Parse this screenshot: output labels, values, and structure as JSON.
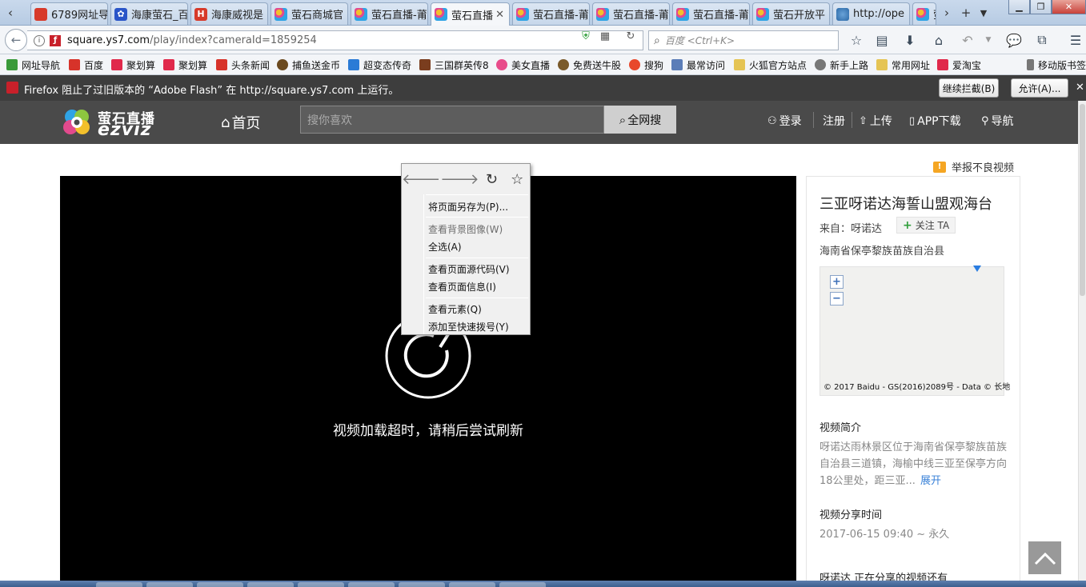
{
  "browser": {
    "tabs": [
      {
        "label": "6789网址导",
        "icon": "red"
      },
      {
        "label": "海康萤石_百",
        "icon": "blue"
      },
      {
        "label": "海康威视是",
        "icon": "red"
      },
      {
        "label": "萤石商城官",
        "icon": "flower"
      },
      {
        "label": "萤石直播-莆",
        "icon": "flower"
      },
      {
        "label": "萤石直播",
        "icon": "flower",
        "active": true
      },
      {
        "label": "萤石直播-莆",
        "icon": "flower"
      },
      {
        "label": "萤石直播-莆",
        "icon": "flower"
      },
      {
        "label": "萤石直播-莆",
        "icon": "flower"
      },
      {
        "label": "萤石开放平",
        "icon": "flower"
      },
      {
        "label": "http://ope",
        "icon": "globe"
      },
      {
        "label": "萤",
        "icon": "flower"
      }
    ],
    "url_domain": "square.ys7.com",
    "url_path": "/play/index?cameraId=1859254",
    "search_placeholder": "百度 <Ctrl+K>",
    "bookmarks": [
      {
        "label": "网址导航",
        "color": "#3a9a3a"
      },
      {
        "label": "百度",
        "color": "#d7332a"
      },
      {
        "label": "聚划算",
        "color": "#e0294b"
      },
      {
        "label": "聚划算",
        "color": "#e0294b"
      },
      {
        "label": "头条新闻",
        "color": "#d7332a"
      },
      {
        "label": "捕鱼送金币",
        "color": "#6b4a1f"
      },
      {
        "label": "超变态传奇",
        "color": "#2b7bd6"
      },
      {
        "label": "三国群英传8",
        "color": "#7a3d1e"
      },
      {
        "label": "美女直播",
        "color": "#e84c8a"
      },
      {
        "label": "免费送牛股",
        "color": "#7a5a2a"
      },
      {
        "label": "搜狗",
        "color": "#e8482c"
      },
      {
        "label": "最常访问",
        "color": "#5b7db8"
      },
      {
        "label": "火狐官方站点",
        "color": "#e5c454"
      },
      {
        "label": "新手上路",
        "color": "#777777"
      },
      {
        "label": "常用网址",
        "color": "#e5c454"
      },
      {
        "label": "爱淘宝",
        "color": "#e0294b"
      },
      {
        "label": "移动版书签",
        "color": "#777777"
      }
    ]
  },
  "flash_notice": {
    "text": "Firefox 阻止了过旧版本的 “Adobe Flash” 在 http://square.ys7.com 上运行。",
    "block_button": "继续拦截(B)",
    "allow_button": "允许(A)..."
  },
  "site": {
    "logo_cn": "萤石直播",
    "logo_en": "ezviz",
    "home": "首页",
    "search_placeholder": "搜你喜欢",
    "search_button": "全网搜",
    "nav": {
      "login": "登录",
      "register": "注册",
      "upload": "上传",
      "app": "APP下载",
      "guide": "导航"
    },
    "report": "举报不良视频"
  },
  "video": {
    "message": "视频加载超时，请稍后尝试刷新"
  },
  "context_menu": {
    "items": [
      {
        "label": "将页面另存为(P)...",
        "disabled": false
      },
      {
        "label": "查看背景图像(W)",
        "disabled": true
      },
      {
        "label": "全选(A)",
        "disabled": false
      },
      {
        "label": "查看页面源代码(V)",
        "disabled": false
      },
      {
        "label": "查看页面信息(I)",
        "disabled": false
      },
      {
        "label": "查看元素(Q)",
        "disabled": false
      },
      {
        "label": "添加至快速拨号(Y)",
        "disabled": false
      }
    ]
  },
  "sidebar": {
    "title": "三亚呀诺达海誓山盟观海台",
    "from": "来自：呀诺达",
    "follow": "关注 TA",
    "location": "海南省保亭黎族苗族自治县",
    "map_copyright": "© 2017 Baidu - GS(2016)2089号 - Data © 长地",
    "intro_title": "视频简介",
    "intro_text": "呀诺达雨林景区位于海南省保亭黎族苗族自治县三道镇，海榆中线三亚至保亭方向18公里处，距三亚...",
    "expand": "展开",
    "share_title": "视频分享时间",
    "share_time": "2017-06-15 09:40 ~ 永久",
    "more": "呀诺达  正在分享的视频还有"
  }
}
